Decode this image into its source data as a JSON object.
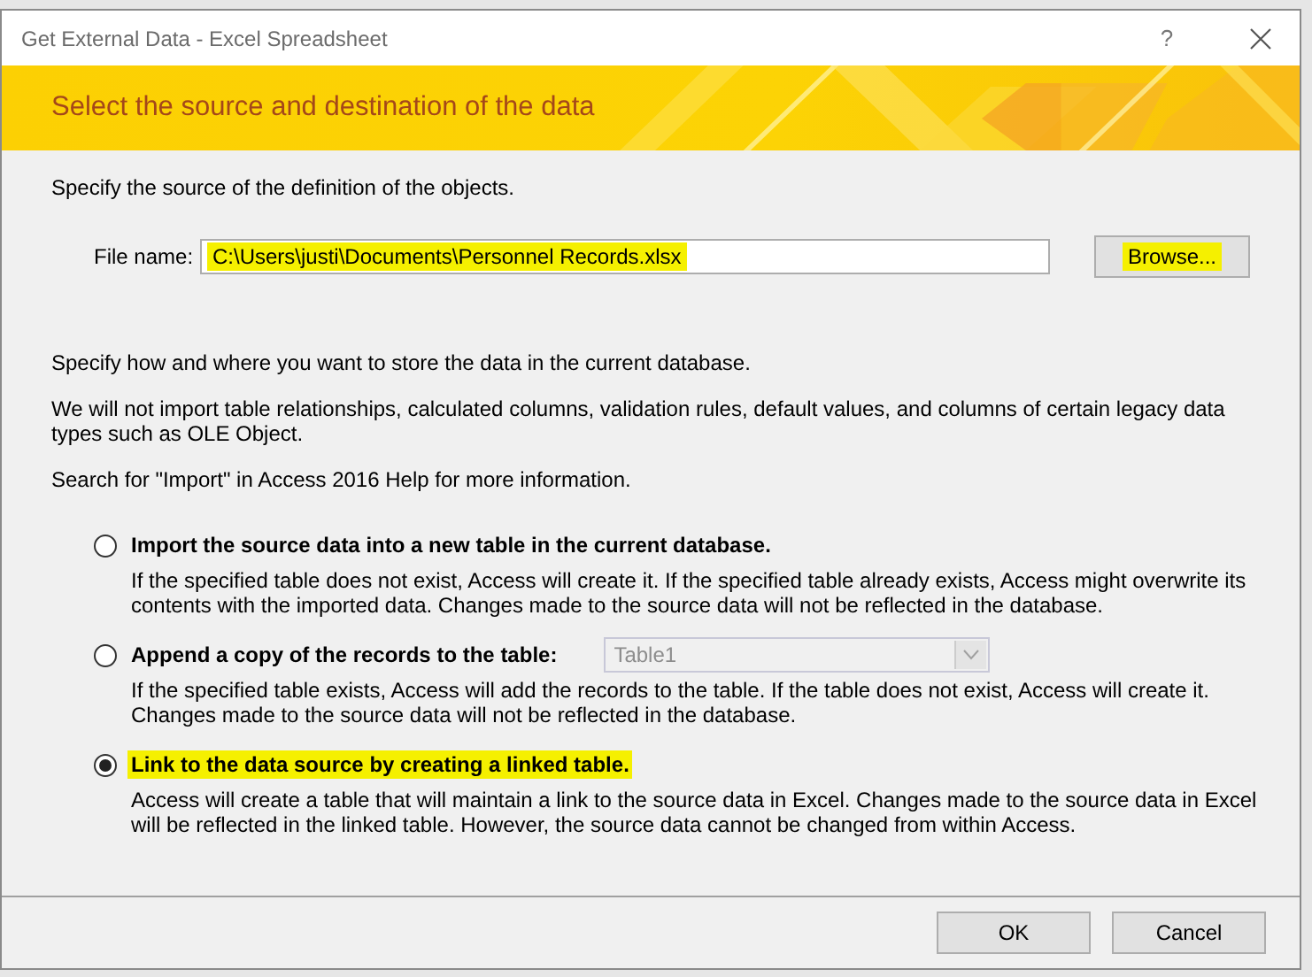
{
  "window": {
    "title": "Get External Data - Excel Spreadsheet",
    "help": "?"
  },
  "banner": {
    "heading": "Select the source and destination of the data"
  },
  "source": {
    "instruction": "Specify the source of the definition of the objects.",
    "file_label": "File name:",
    "file_value": "C:\\Users\\justi\\Documents\\Personnel Records.xlsx",
    "file_highlighted": true,
    "browse": {
      "label": "Browse...",
      "highlighted": true
    }
  },
  "storage": {
    "paragraphs": [
      "Specify how and where you want to store the data in the current database.",
      "We will not import table relationships, calculated columns, validation rules, default values, and columns of certain legacy data types such as OLE Object.",
      "Search for \"Import\" in Access 2016 Help for more information."
    ]
  },
  "options": [
    {
      "kind": "plain",
      "label": "Import the source data into a new table in the current database.",
      "description": "If the specified table does not exist, Access will create it. If the specified table already exists, Access might overwrite its contents with the imported data. Changes made to the source data will not be reflected in the database.",
      "selected": false,
      "highlighted": false
    },
    {
      "kind": "table-select",
      "label": "Append a copy of the records to the table:",
      "table": "Table1",
      "disabled": true,
      "description": "If the specified table exists, Access will add the records to the table. If the table does not exist, Access will create it. Changes made to the source data will not be reflected in the database.",
      "selected": false,
      "highlighted": false
    },
    {
      "kind": "plain",
      "label": "Link to the data source by creating a linked table.",
      "description": "Access will create a table that will maintain a link to the source data in Excel. Changes made to the source data in Excel will be reflected in the linked table. However, the source data cannot be changed from within Access.",
      "selected": true,
      "highlighted": true
    }
  ],
  "buttons": [
    {
      "label": "OK"
    },
    {
      "label": "Cancel"
    }
  ]
}
